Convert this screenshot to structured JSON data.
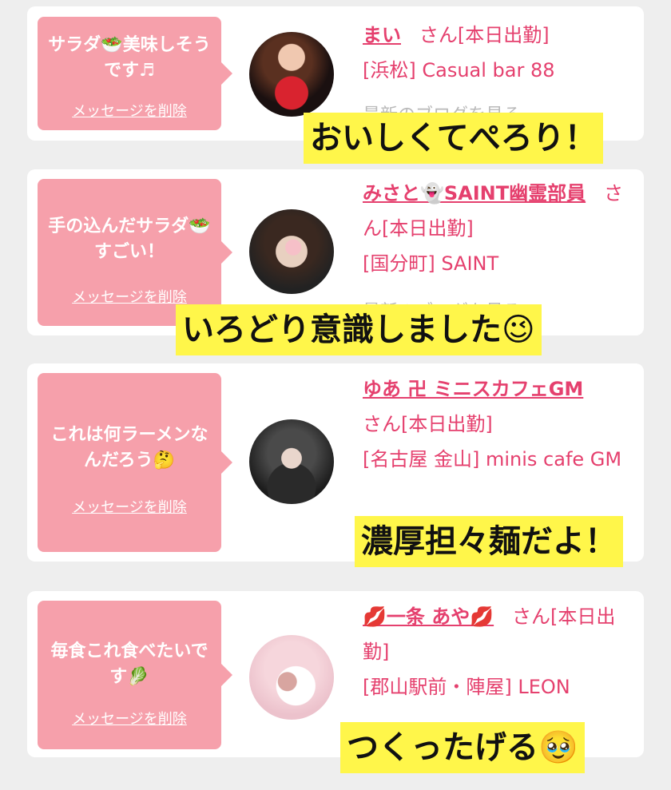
{
  "delete_label": "メッセージを削除",
  "blog_label": "最新のブログを見る",
  "colors": {
    "accent": "#e5406e",
    "bubble": "#f6a0ab",
    "caption_bg": "#fff64a"
  },
  "items": [
    {
      "message": "サラダ🥗美味しそうです♬",
      "name": "まい",
      "suffix": "さん[本日出勤]",
      "shop": "[浜松] Casual bar 88",
      "caption": "おいしくてぺろり！"
    },
    {
      "message": "手の込んだサラダ🥗すごい！",
      "name": "みさと👻SAINT幽霊部員",
      "suffix": "さん[本日出勤]",
      "shop": "[国分町] SAINT",
      "caption": "いろどり意識しました😉"
    },
    {
      "message": "これは何ラーメンなんだろう🤔",
      "name": "ゆあ 卍 ミニスカフェGM",
      "suffix": "さん[本日出勤]",
      "shop": "[名古屋 金山] minis cafe GM",
      "caption": "濃厚担々麺だよ！"
    },
    {
      "message": "毎食これ食べたいです🥬",
      "name": "💋一条 あや💋",
      "suffix": "さん[本日出勤]",
      "shop": "[郡山駅前・陣屋] LEON",
      "caption": "つくったげる🥹"
    }
  ]
}
